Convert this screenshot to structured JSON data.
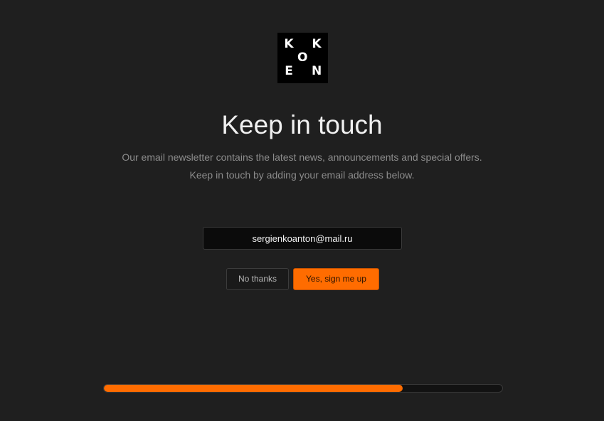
{
  "logo": {
    "letters": [
      "K",
      "K",
      "O",
      "E",
      "N"
    ]
  },
  "title": "Keep in touch",
  "description": {
    "line1": "Our email newsletter contains the latest news, announcements and special offers.",
    "line2": "Keep in touch by adding your email address below."
  },
  "email_input": {
    "value": "sergienkoanton@mail.ru"
  },
  "buttons": {
    "no_thanks": "No thanks",
    "sign_up": "Yes, sign me up"
  },
  "progress": {
    "fraction": 0.75
  },
  "colors": {
    "background": "#1f1f1f",
    "accent": "#ff6c00"
  }
}
